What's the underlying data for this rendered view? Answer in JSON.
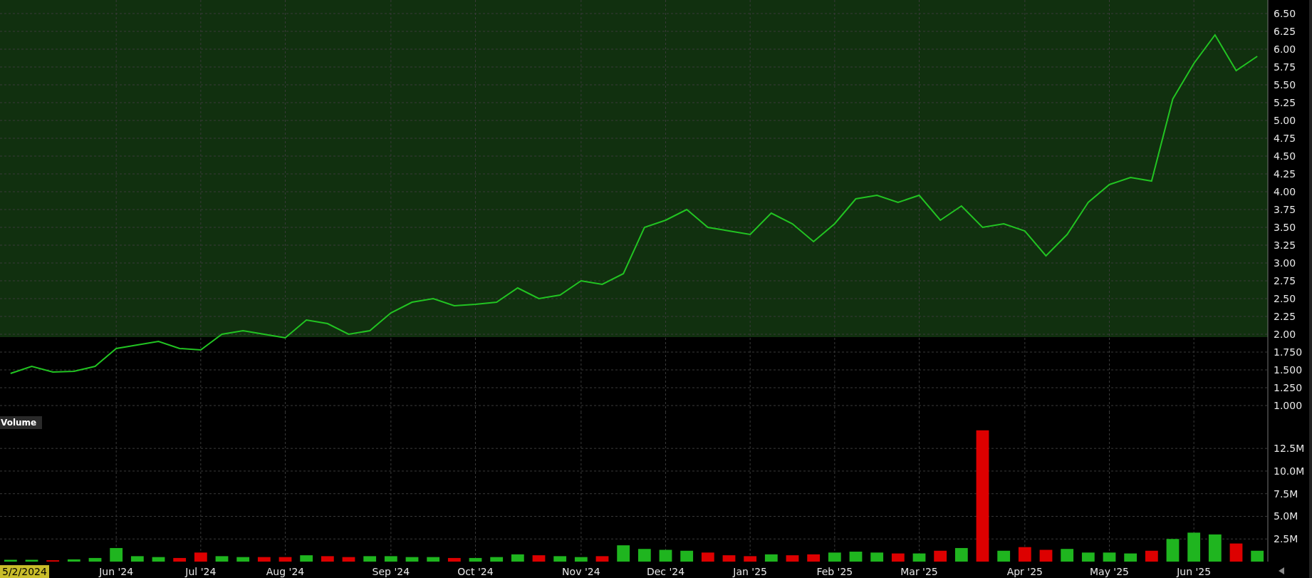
{
  "price_pane": {
    "chart_data": {
      "type": "line",
      "ylim": [
        0.91,
        6.69
      ],
      "series": [
        {
          "color": "#22c322",
          "values": [
            1.45,
            1.55,
            1.47,
            1.48,
            1.55,
            1.8,
            1.85,
            1.9,
            1.8,
            1.78,
            2.0,
            2.05,
            2.0,
            1.95,
            2.2,
            2.15,
            2.0,
            2.05,
            2.3,
            2.45,
            2.5,
            2.4,
            2.42,
            2.45,
            2.65,
            2.5,
            2.55,
            2.75,
            2.7,
            2.85,
            3.5,
            3.6,
            3.75,
            3.5,
            3.45,
            3.4,
            3.7,
            3.55,
            3.3,
            3.55,
            3.9,
            3.95,
            3.85,
            3.95,
            3.6,
            3.8,
            3.5,
            3.55,
            3.45,
            3.1,
            3.4,
            3.85,
            4.1,
            4.2,
            4.15,
            5.3,
            5.8,
            6.2,
            5.7,
            5.9
          ]
        }
      ],
      "yticks": [
        {
          "value": 6.5,
          "label": "6.50"
        },
        {
          "value": 6.25,
          "label": "6.25"
        },
        {
          "value": 6,
          "label": "6.00"
        },
        {
          "value": 5.75,
          "label": "5.75"
        },
        {
          "value": 5.5,
          "label": "5.50"
        },
        {
          "value": 5.25,
          "label": "5.25"
        },
        {
          "value": 5,
          "label": "5.00"
        },
        {
          "value": 4.75,
          "label": "4.75"
        },
        {
          "value": 4.5,
          "label": "4.50"
        },
        {
          "value": 4.25,
          "label": "4.25"
        },
        {
          "value": 4,
          "label": "4.00"
        },
        {
          "value": 3.75,
          "label": "3.75"
        },
        {
          "value": 3.5,
          "label": "3.50"
        },
        {
          "value": 3.25,
          "label": "3.25"
        },
        {
          "value": 3,
          "label": "3.00"
        },
        {
          "value": 2.75,
          "label": "2.75"
        },
        {
          "value": 2.5,
          "label": "2.50"
        },
        {
          "value": 2.25,
          "label": "2.25"
        },
        {
          "value": 2,
          "label": "2.00"
        },
        {
          "value": 1.75,
          "label": "1.750"
        },
        {
          "value": 1.5,
          "label": "1.500"
        },
        {
          "value": 1.25,
          "label": "1.250"
        },
        {
          "value": 1,
          "label": "1.000"
        }
      ],
      "grid": true
    }
  },
  "volume_pane": {
    "title": "Volume",
    "cursor_date": "5/2/2024",
    "chart_data": {
      "type": "bar",
      "ylim": [
        0,
        15.9
      ],
      "grid": true,
      "categories": [
        null,
        null,
        null,
        null,
        null,
        "Jun '24",
        null,
        null,
        null,
        "Jul '24",
        null,
        null,
        null,
        "Aug '24",
        null,
        null,
        null,
        null,
        "Sep '24",
        null,
        null,
        null,
        "Oct '24",
        null,
        null,
        null,
        null,
        "Nov '24",
        null,
        null,
        null,
        "Dec '24",
        null,
        null,
        null,
        "Jan '25",
        null,
        null,
        null,
        "Feb '25",
        null,
        null,
        null,
        "Mar '25",
        null,
        null,
        null,
        null,
        "Apr '25",
        null,
        null,
        null,
        "May '25",
        null,
        null,
        null,
        "Jun '25",
        null,
        null,
        null
      ],
      "series": [
        {
          "color": "#1fb51f",
          "values": [
            0.2,
            0.2,
            null,
            0.25,
            0.4,
            1.5,
            0.6,
            0.5,
            null,
            null,
            0.6,
            0.5,
            null,
            null,
            0.7,
            null,
            null,
            0.6,
            0.6,
            0.5,
            0.5,
            null,
            0.4,
            0.5,
            0.8,
            null,
            0.6,
            0.5,
            null,
            1.8,
            1.4,
            1.3,
            1.2,
            null,
            null,
            null,
            0.8,
            null,
            null,
            1.0,
            1.1,
            1.0,
            null,
            0.9,
            null,
            1.5,
            null,
            1.2,
            null,
            null,
            1.4,
            1.0,
            1.0,
            0.9,
            null,
            2.5,
            3.2,
            3.0,
            null,
            1.2
          ]
        },
        {
          "color": "#dd0000",
          "values": [
            null,
            null,
            0.15,
            null,
            null,
            null,
            null,
            null,
            0.4,
            1.0,
            null,
            null,
            0.5,
            0.5,
            null,
            0.6,
            0.5,
            null,
            null,
            null,
            null,
            0.4,
            null,
            null,
            null,
            0.7,
            null,
            null,
            0.6,
            null,
            null,
            null,
            null,
            1.0,
            0.7,
            0.6,
            null,
            0.7,
            0.8,
            null,
            null,
            null,
            0.9,
            null,
            1.2,
            null,
            14.5,
            null,
            1.6,
            1.3,
            null,
            null,
            null,
            null,
            1.2,
            null,
            null,
            null,
            2.0,
            null
          ]
        }
      ],
      "yticks": [
        {
          "value": 2.5,
          "label": "2.5M"
        },
        {
          "value": 5,
          "label": "5.0M"
        },
        {
          "value": 7.5,
          "label": "7.5M"
        },
        {
          "value": 10,
          "label": "10.0M"
        },
        {
          "value": 12.5,
          "label": "12.5M"
        }
      ]
    }
  }
}
